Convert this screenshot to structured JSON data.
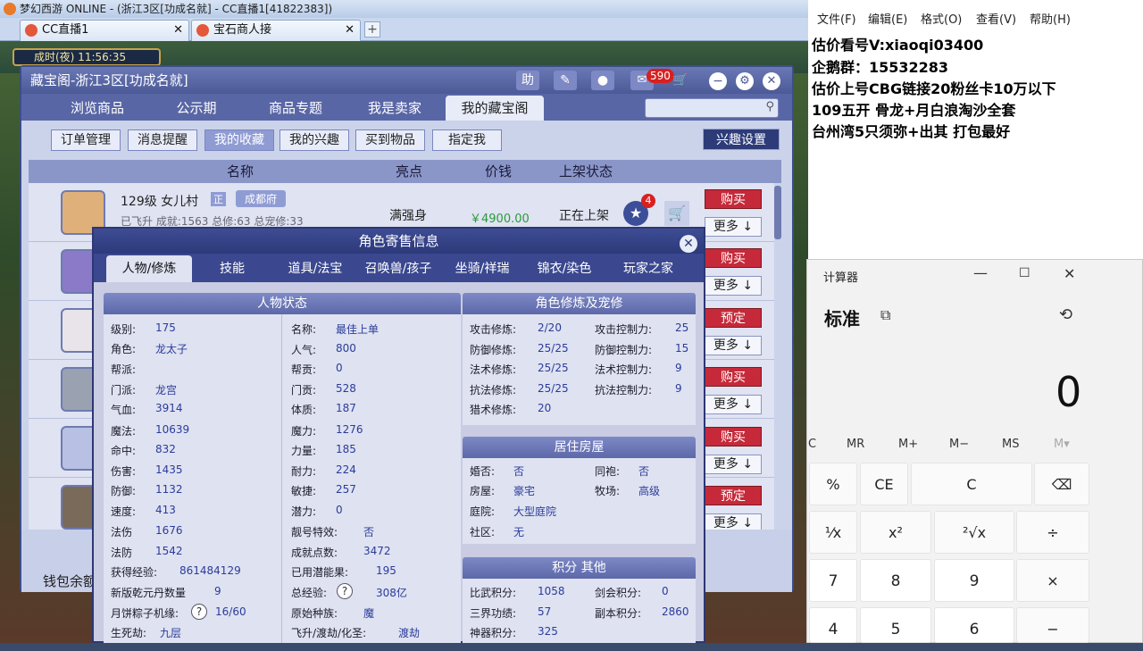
{
  "browser": {
    "window_title": "梦幻西游 ONLINE - (浙江3区[功成名就] - CC直播1[41822383])",
    "tabs": [
      {
        "label": "CC直播1"
      },
      {
        "label": "宝石商人接"
      }
    ],
    "clock": "成时(夜)  11:56:35"
  },
  "cbg": {
    "title": "藏宝阁-浙江3区[功成名就]",
    "header_icons": [
      "助"
    ],
    "msg_badge": "590",
    "nav_tabs": [
      "浏览商品",
      "公示期",
      "商品专题",
      "我是卖家",
      "我的藏宝阁"
    ],
    "sub_tabs": [
      "订单管理",
      "消息提醒",
      "我的收藏",
      "我的兴趣",
      "买到物品",
      "指定我"
    ],
    "interest_settings": "兴趣设置",
    "columns": [
      "名称",
      "亮点",
      "价钱",
      "上架状态"
    ],
    "first_row": {
      "level_school": "129级 女儿村",
      "tag": "成都府",
      "desc": "已飞升 成就:1563 总修:63 总宠修:33",
      "highlight": "满强身",
      "price": "￥4900.00",
      "status": "正在上架",
      "fav_count": "4"
    },
    "row_actions": [
      "购买",
      "购买",
      "预定",
      "购买",
      "购买",
      "预定"
    ],
    "more_label": "更多",
    "wallet": "钱包余额"
  },
  "modal": {
    "title": "角色寄售信息",
    "tabs": [
      "人物/修炼",
      "技能",
      "道具/法宝",
      "召唤兽/孩子",
      "坐骑/祥瑞",
      "锦衣/染色",
      "玩家之家"
    ],
    "status_title": "人物状态",
    "left_fields": [
      {
        "label": "级别:",
        "value": "175"
      },
      {
        "label": "角色:",
        "value": "龙太子"
      },
      {
        "label": "帮派:",
        "value": ""
      },
      {
        "label": "门派:",
        "value": "龙宫"
      },
      {
        "label": "气血:",
        "value": "3914"
      },
      {
        "label": "魔法:",
        "value": "10639"
      },
      {
        "label": "命中:",
        "value": "832"
      },
      {
        "label": "伤害:",
        "value": "1435"
      },
      {
        "label": "防御:",
        "value": "1132"
      },
      {
        "label": "速度:",
        "value": "413"
      },
      {
        "label": "法伤",
        "value": "1676"
      },
      {
        "label": "法防",
        "value": "1542"
      },
      {
        "label": "获得经验:",
        "value": "861484129"
      },
      {
        "label": "新版乾元丹数量",
        "value": "9"
      },
      {
        "label": "月饼粽子机缘:",
        "value": "16/60"
      },
      {
        "label": "生死劫:",
        "value": "九层"
      }
    ],
    "mid_fields": [
      {
        "label": "名称:",
        "value": "最佳上单"
      },
      {
        "label": "人气:",
        "value": "800"
      },
      {
        "label": "帮贡:",
        "value": "0"
      },
      {
        "label": "门贡:",
        "value": "528"
      },
      {
        "label": "体质:",
        "value": "187"
      },
      {
        "label": "魔力:",
        "value": "1276"
      },
      {
        "label": "力量:",
        "value": "185"
      },
      {
        "label": "耐力:",
        "value": "224"
      },
      {
        "label": "敏捷:",
        "value": "257"
      },
      {
        "label": "潜力:",
        "value": "0"
      },
      {
        "label": "靓号特效:",
        "value": "否"
      },
      {
        "label": "成就点数:",
        "value": "3472"
      },
      {
        "label": "已用潜能果:",
        "value": "195"
      },
      {
        "label": "总经验:",
        "value": "308亿"
      },
      {
        "label": "原始种族:",
        "value": "魔"
      },
      {
        "label": "飞升/渡劫/化圣:",
        "value": "渡劫"
      }
    ],
    "cultivation_title": "角色修炼及宠修",
    "cultivation": [
      {
        "label": "攻击修炼:",
        "value": "2/20",
        "label2": "攻击控制力:",
        "value2": "25"
      },
      {
        "label": "防御修炼:",
        "value": "25/25",
        "label2": "防御控制力:",
        "value2": "15"
      },
      {
        "label": "法术修炼:",
        "value": "25/25",
        "label2": "法术控制力:",
        "value2": "9"
      },
      {
        "label": "抗法修炼:",
        "value": "25/25",
        "label2": "抗法控制力:",
        "value2": "9"
      },
      {
        "label": "猎术修炼:",
        "value": "20",
        "label2": "",
        "value2": ""
      }
    ],
    "house_title": "居住房屋",
    "house": [
      {
        "label": "婚否:",
        "value": "否",
        "label2": "同袍:",
        "value2": "否"
      },
      {
        "label": "房屋:",
        "value": "豪宅",
        "label2": "牧场:",
        "value2": "高级"
      },
      {
        "label": "庭院:",
        "value": "大型庭院",
        "label2": "",
        "value2": ""
      },
      {
        "label": "社区:",
        "value": "无",
        "label2": "",
        "value2": ""
      }
    ],
    "points_title": "积分 其他",
    "points": [
      {
        "label": "比武积分:",
        "value": "1058",
        "label2": "剑会积分:",
        "value2": "0"
      },
      {
        "label": "三界功绩:",
        "value": "57",
        "label2": "副本积分:",
        "value2": "2860"
      },
      {
        "label": "神器积分:",
        "value": "325",
        "label2": "",
        "value2": ""
      }
    ]
  },
  "notepad": {
    "menu": [
      "文件(F)",
      "编辑(E)",
      "格式(O)",
      "查看(V)",
      "帮助(H)"
    ],
    "lines": [
      "估价看号V:xiaoqi03400",
      "企鹅群：15532283",
      "估价上号CBG链接20粉丝卡10万以下",
      "109五开 骨龙+月白浪淘沙全套",
      "台州湾5只须弥+出其 打包最好"
    ]
  },
  "calculator": {
    "title": "计算器",
    "mode": "标准",
    "display": "0",
    "memory": [
      "C",
      "MR",
      "M+",
      "M−",
      "MS",
      "M▾"
    ],
    "keys": [
      [
        "%",
        "CE",
        "C",
        "⌫"
      ],
      [
        "¹⁄x",
        "x²",
        "²√x",
        "÷"
      ],
      [
        "7",
        "8",
        "9",
        "×"
      ],
      [
        "4",
        "5",
        "6",
        "−"
      ]
    ]
  }
}
